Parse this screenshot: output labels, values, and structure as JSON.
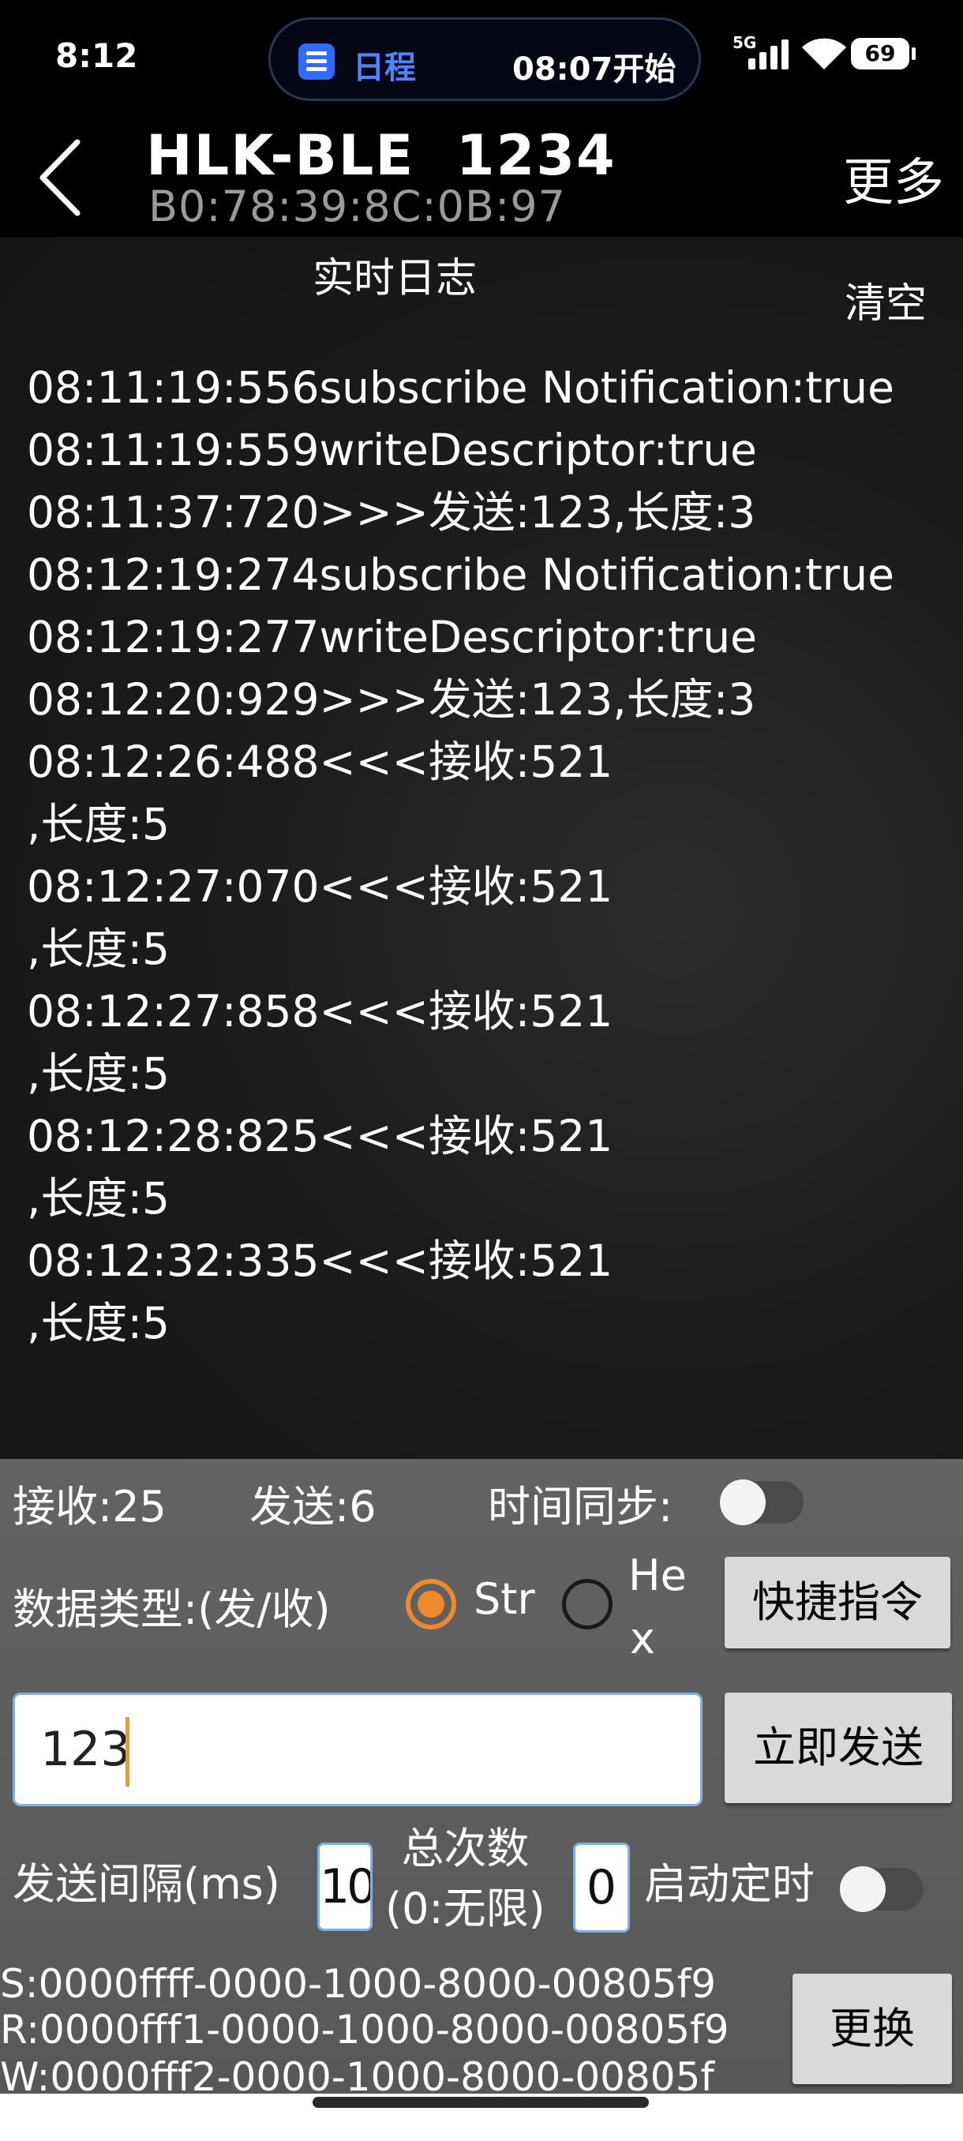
{
  "status_bar": {
    "time": "8:12",
    "notification_app": "日程",
    "notification_text": "08:07开始",
    "network": "5G",
    "battery": "69"
  },
  "header": {
    "device_name": "HLK-BLE  1234",
    "mac_address": "B0:78:39:8C:0B:97",
    "more_label": "更多"
  },
  "log": {
    "title": "实时日志",
    "clear_label": "清空",
    "lines": [
      "08:11:19:556subscribe Notification:true",
      "08:11:19:559writeDescriptor:true",
      "08:11:37:720>>>发送:123,长度:3",
      "08:12:19:274subscribe Notification:true",
      "08:12:19:277writeDescriptor:true",
      "08:12:20:929>>>发送:123,长度:3",
      "08:12:26:488<<<接收:521",
      ",长度:5",
      "08:12:27:070<<<接收:521",
      ",长度:5",
      "08:12:27:858<<<接收:521",
      ",长度:5",
      "08:12:28:825<<<接收:521",
      ",长度:5",
      "08:12:32:335<<<接收:521",
      ",长度:5"
    ]
  },
  "panel": {
    "receive_count": "接收:25",
    "send_count": "发送:6",
    "time_sync_label": "时间同步:",
    "data_type_label": "数据类型:(发/收)",
    "option_str": "Str",
    "option_hex_line1": "He",
    "option_hex_line2": "x",
    "shortcut_label": "快捷指令",
    "send_input_value": "123",
    "send_now_label": "立即发送",
    "interval_label": "发送间隔(ms)",
    "interval_value": "10",
    "total_label_line1": "总次数",
    "total_label_line2": "(0:无限)",
    "total_value": "0",
    "timer_label": "启动定时",
    "uuid_service": "S:0000ffff-0000-1000-8000-00805f9",
    "uuid_read": "R:0000fff1-0000-1000-8000-00805f9",
    "uuid_write": "W:0000fff2-0000-1000-8000-00805f",
    "change_label": "更换"
  },
  "colors": {
    "accent_orange": "#ef8a2a",
    "calendar_blue": "#2f6bff",
    "input_border": "#7fb0e6"
  }
}
